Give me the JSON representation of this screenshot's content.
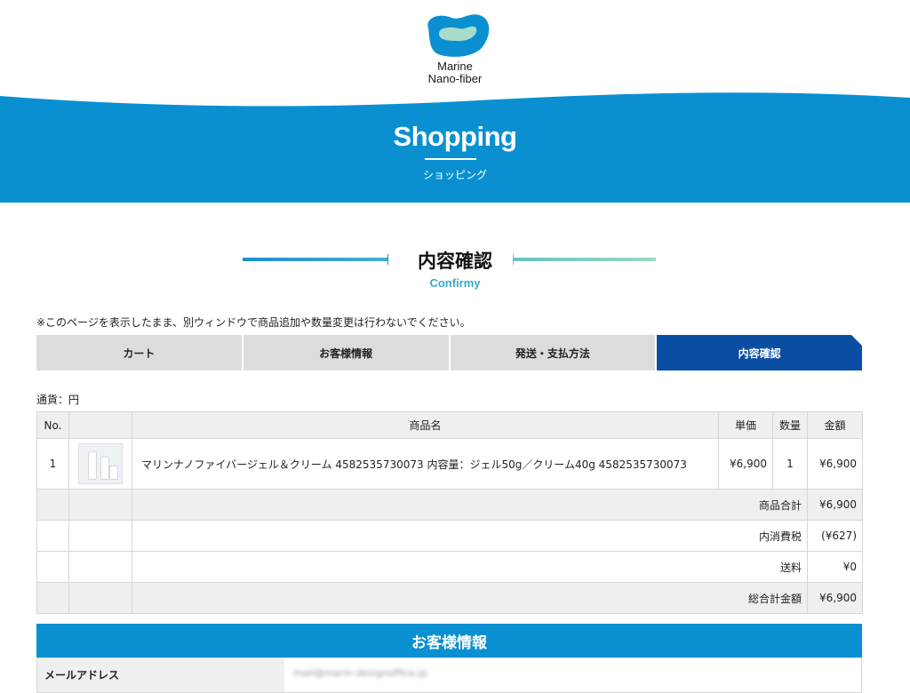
{
  "brand": {
    "line1": "Marine",
    "line2": "Nano-fiber"
  },
  "hero": {
    "title": "Shopping",
    "subtitle": "ショッピング"
  },
  "section": {
    "title": "内容確認",
    "subtitle": "Confirmy"
  },
  "notice": "※このページを表示したまま、別ウィンドウで商品追加や数量変更は行わないでください。",
  "steps": [
    "カート",
    "お客様情報",
    "発送・支払方法",
    "内容確認"
  ],
  "active_step": 3,
  "currency": "通貨：円",
  "table": {
    "headers": {
      "no": "No.",
      "image": "",
      "name": "商品名",
      "unit_price": "単価",
      "qty": "数量",
      "amount": "金額"
    },
    "items": [
      {
        "no": "1",
        "name": "マリンナノファイバージェル＆クリーム 4582535730073 内容量：ジェル50g／クリーム40g 4582535730073",
        "unit_price": "¥6,900",
        "qty": "1",
        "amount": "¥6,900"
      }
    ],
    "summary": [
      {
        "label": "商品合計",
        "value": "¥6,900"
      },
      {
        "label": "内消費税",
        "value": "(¥627)"
      },
      {
        "label": "送料",
        "value": "¥0"
      },
      {
        "label": "総合計金額",
        "value": "¥6,900"
      }
    ]
  },
  "customer": {
    "title": "お客様情報",
    "email_label": "メールアドレス",
    "email_value": "mail@marin-designoffice.jp"
  },
  "colors": {
    "primary": "#0a90d1",
    "active_step": "#0a4ea3",
    "accent": "#3aa7c9"
  }
}
